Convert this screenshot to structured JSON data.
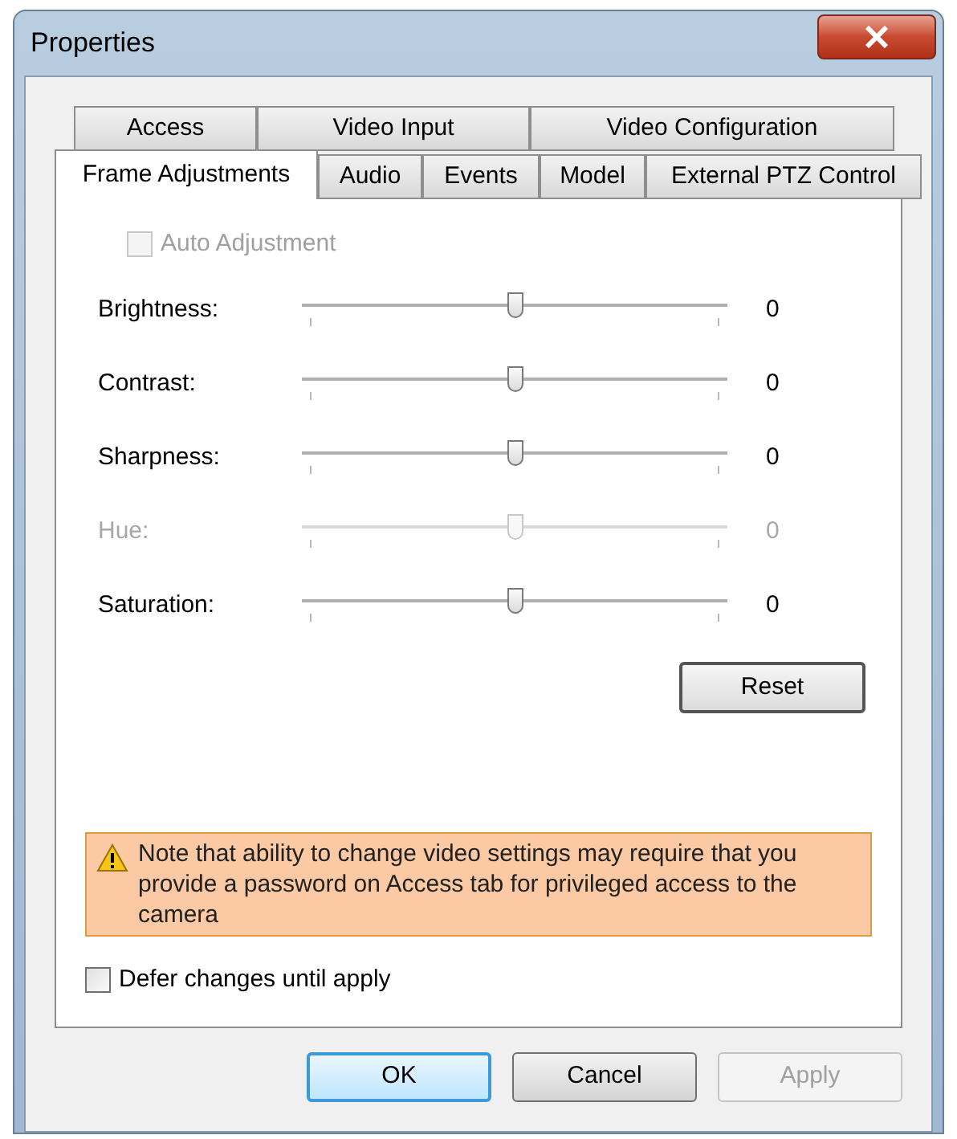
{
  "window": {
    "title": "Properties"
  },
  "tabs": [
    [
      {
        "label": "Access",
        "selected": false
      },
      {
        "label": "Video Input",
        "selected": false
      },
      {
        "label": "Video Configuration",
        "selected": false
      }
    ],
    [
      {
        "label": "Frame Adjustments",
        "selected": true
      },
      {
        "label": "Audio",
        "selected": false
      },
      {
        "label": "Events",
        "selected": false
      },
      {
        "label": "Model",
        "selected": false
      },
      {
        "label": "External PTZ Control",
        "selected": false
      }
    ]
  ],
  "auto_adjustment": {
    "label": "Auto Adjustment",
    "checked": false,
    "disabled": true
  },
  "sliders": [
    {
      "label": "Brightness:",
      "level": 0.5,
      "reading": "0",
      "disabled": false
    },
    {
      "label": "Contrast:",
      "level": 0.5,
      "reading": "0",
      "disabled": false
    },
    {
      "label": "Sharpness:",
      "level": 0.5,
      "reading": "0",
      "disabled": false
    },
    {
      "label": "Hue:",
      "level": 0.5,
      "reading": "0",
      "disabled": true
    },
    {
      "label": "Saturation:",
      "level": 0.5,
      "reading": "0",
      "disabled": false
    }
  ],
  "reset_button": "Reset",
  "note": "Note that ability to change video settings may require that you provide a password on Access tab for privileged access to the camera",
  "defer": {
    "label": "Defer changes until apply",
    "checked": false
  },
  "buttons": [
    {
      "label": "OK",
      "kind": "default",
      "disabled": false
    },
    {
      "label": "Cancel",
      "kind": "normal",
      "disabled": false
    },
    {
      "label": "Apply",
      "kind": "normal",
      "disabled": true
    }
  ]
}
